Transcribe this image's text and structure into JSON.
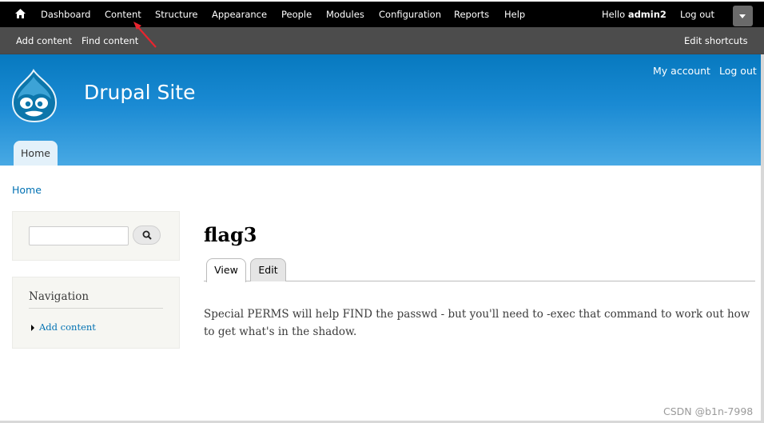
{
  "toolbar": {
    "menu": [
      "Dashboard",
      "Content",
      "Structure",
      "Appearance",
      "People",
      "Modules",
      "Configuration",
      "Reports",
      "Help"
    ],
    "hello_prefix": "Hello",
    "username": "admin2",
    "logout": "Log out",
    "shortcuts": [
      "Add content",
      "Find content"
    ],
    "edit_shortcuts": "Edit shortcuts",
    "icons": [
      "home-icon",
      "chevron-down-icon"
    ]
  },
  "header": {
    "site_name": "Drupal Site",
    "secondary_menu": [
      "My account",
      "Log out"
    ],
    "main_tab": "Home"
  },
  "breadcrumb": "Home",
  "sidebar": {
    "search_placeholder": "",
    "navigation_title": "Navigation",
    "nav_items": [
      "Add content"
    ]
  },
  "main": {
    "title": "flag3",
    "tabs": [
      "View",
      "Edit"
    ],
    "active_tab": "View",
    "body": "Special PERMS will help FIND the passwd - but you'll need to -exec that command to work out how to get what's in the shadow."
  },
  "watermark": "CSDN @b1n-7998",
  "colors": {
    "toolbar_primary": "#000000",
    "toolbar_secondary": "#4c4c4c",
    "header_blue": "#0779bf",
    "link_blue": "#0071b3",
    "annotation_red": "#e8242e"
  }
}
